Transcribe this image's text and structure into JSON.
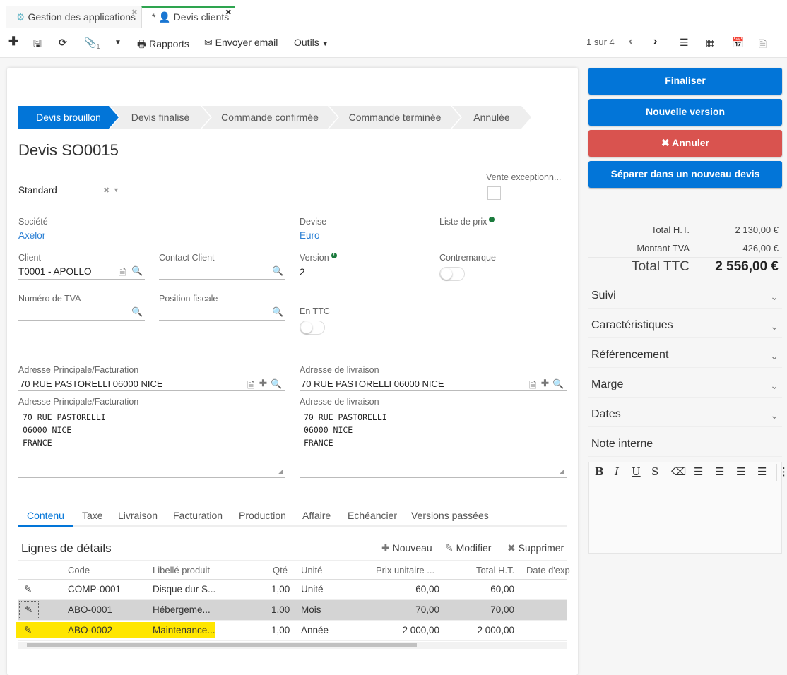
{
  "tabs": [
    {
      "label": "Gestion des applications",
      "icon": "gear-icon",
      "active": false
    },
    {
      "label": "* ",
      "label2": "Devis clients",
      "icon": "user-icon",
      "active": true
    }
  ],
  "toolbar": {
    "new": "+",
    "save": "save",
    "refresh": "refresh",
    "attachments_count": "1",
    "reports": "Rapports",
    "send_email": "Envoyer email",
    "tools": "Outils",
    "pager": "1 sur 4"
  },
  "status_steps": [
    "Devis brouillon",
    "Devis finalisé",
    "Commande confirmée",
    "Commande terminée",
    "Annulée"
  ],
  "title": "Devis SO0015",
  "form": {
    "type_value": "Standard",
    "vente_exceptionnelle_label": "Vente exceptionn...",
    "societe_label": "Société",
    "societe_value": "Axelor",
    "devise_label": "Devise",
    "devise_value": "Euro",
    "liste_prix_label": "Liste de prix",
    "client_label": "Client",
    "client_value": "T0001 - APOLLO",
    "contact_label": "Contact Client",
    "version_label": "Version",
    "version_value": "2",
    "contremarque_label": "Contremarque",
    "tva_label": "Numéro de TVA",
    "position_label": "Position fiscale",
    "ttc_label": "En TTC",
    "addr_main_label": "Adresse Principale/Facturation",
    "addr_main_value": "70 RUE PASTORELLI 06000 NICE",
    "addr_main_text_label": "Adresse Principale/Facturation",
    "addr_main_text": "70 RUE PASTORELLI\n06000 NICE\nFRANCE",
    "addr_del_label": "Adresse de livraison",
    "addr_del_value": "70 RUE PASTORELLI 06000 NICE",
    "addr_del_text_label": "Adresse de livraison",
    "addr_del_text": "70 RUE PASTORELLI\n06000 NICE\nFRANCE"
  },
  "form_tabs": [
    "Contenu",
    "Taxe",
    "Livraison",
    "Facturation",
    "Production",
    "Affaire",
    "Echéancier",
    "Versions passées"
  ],
  "lines": {
    "title": "Lignes de détails",
    "actions": {
      "new": "Nouveau",
      "edit": "Modifier",
      "delete": "Supprimer"
    },
    "columns": [
      "Code",
      "Libellé produit",
      "Qté",
      "Unité",
      "Prix unitaire ...",
      "Total H.T.",
      "Date d'exp"
    ],
    "rows": [
      {
        "code": "COMP-0001",
        "label": "Disque dur S...",
        "qty": "1,00",
        "unit": "Unité",
        "price": "60,00",
        "total": "60,00"
      },
      {
        "code": "ABO-0001",
        "label": "Hébergeme...",
        "qty": "1,00",
        "unit": "Mois",
        "price": "70,00",
        "total": "70,00"
      },
      {
        "code": "ABO-0002",
        "label": "Maintenance...",
        "qty": "1,00",
        "unit": "Année",
        "price": "2 000,00",
        "total": "2 000,00"
      }
    ]
  },
  "side": {
    "buttons": [
      "Finaliser",
      "Nouvelle version",
      "Annuler",
      "Séparer dans un nouveau devis"
    ],
    "totals": {
      "ht_label": "Total H.T.",
      "ht_value": "2 130,00 €",
      "tva_label": "Montant TVA",
      "tva_value": "426,00 €",
      "ttc_label": "Total TTC",
      "ttc_value": "2 556,00 €"
    },
    "sections": [
      "Suivi",
      "Caractéristiques",
      "Référencement",
      "Marge",
      "Dates"
    ],
    "note_title": "Note interne"
  },
  "colors": {
    "primary": "#0275d8",
    "danger": "#d9534f",
    "highlight": "#ffe600",
    "active_tab": "#2ea44f"
  }
}
